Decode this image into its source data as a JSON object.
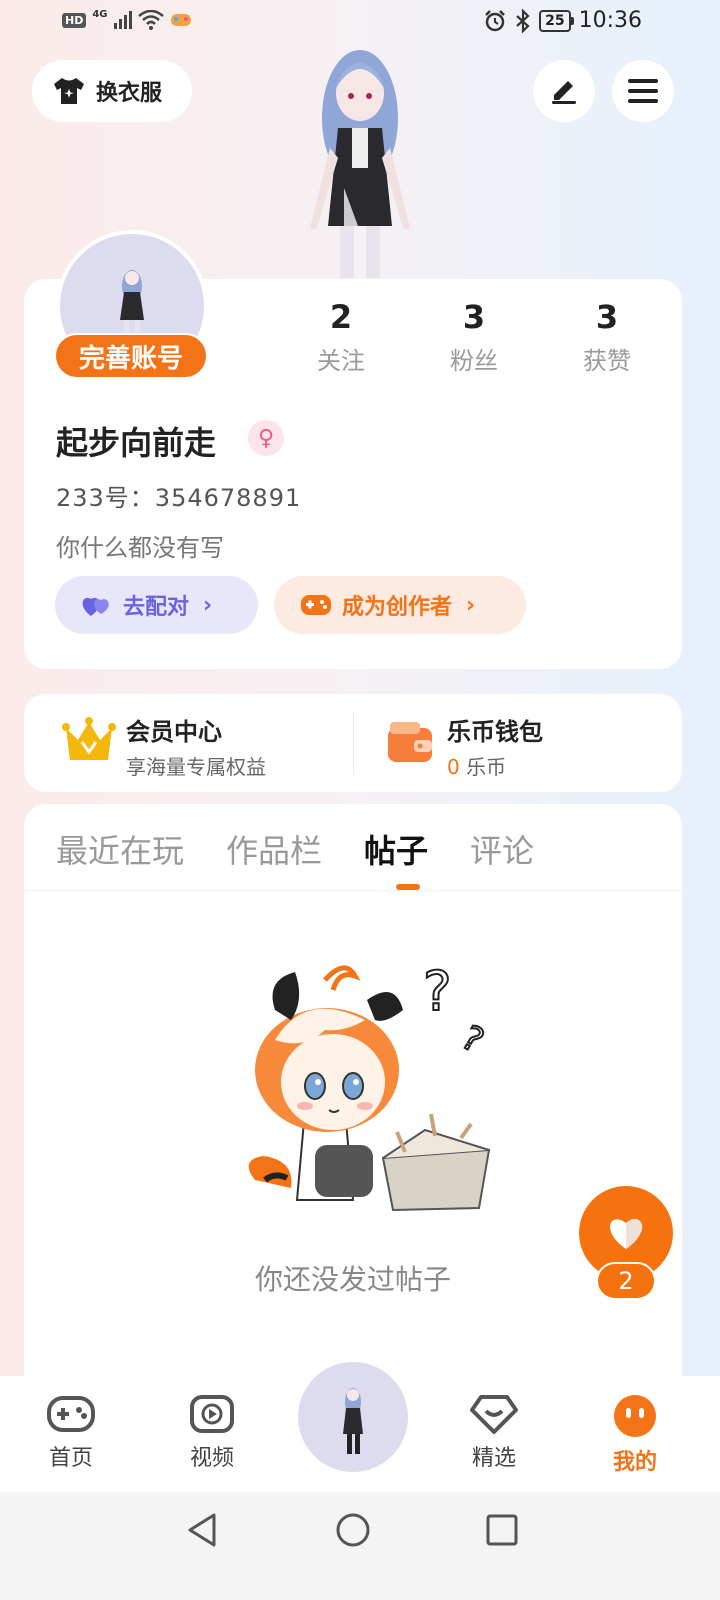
{
  "status_bar": {
    "network": "4G",
    "hd": "HD",
    "battery": "25",
    "time": "10:36"
  },
  "top": {
    "wardrobe_label": "换衣服"
  },
  "profile": {
    "complete_badge": "完善账号",
    "stats": [
      {
        "value": "2",
        "label": "关注"
      },
      {
        "value": "3",
        "label": "粉丝"
      },
      {
        "value": "3",
        "label": "获赞"
      }
    ],
    "username": "起步向前走",
    "gender_symbol": "♀",
    "uid": "233号：354678891",
    "bio": "你什么都没有写",
    "match_label": "去配对",
    "creator_label": "成为创作者",
    "chevron": "›"
  },
  "member": {
    "title": "会员中心",
    "subtitle": "享海量专属权益"
  },
  "wallet": {
    "title": "乐币钱包",
    "amount": "0",
    "unit": "乐币"
  },
  "tabs": [
    {
      "label": "最近在玩",
      "active": false
    },
    {
      "label": "作品栏",
      "active": false
    },
    {
      "label": "帖子",
      "active": true
    },
    {
      "label": "评论",
      "active": false
    }
  ],
  "empty_state": {
    "text": "你还没发过帖子"
  },
  "like_fab": {
    "count": "2"
  },
  "bottom_nav": [
    {
      "label": "首页",
      "icon": "gamepad-icon"
    },
    {
      "label": "视频",
      "icon": "video-play-icon"
    },
    {
      "label": "",
      "icon": "avatar-center"
    },
    {
      "label": "精选",
      "icon": "heart-box-icon"
    },
    {
      "label": "我的",
      "icon": "face-icon",
      "active": true
    }
  ],
  "colors": {
    "accent": "#f47316",
    "match": "#6a63e0",
    "member_gold": "#f6b70c"
  }
}
